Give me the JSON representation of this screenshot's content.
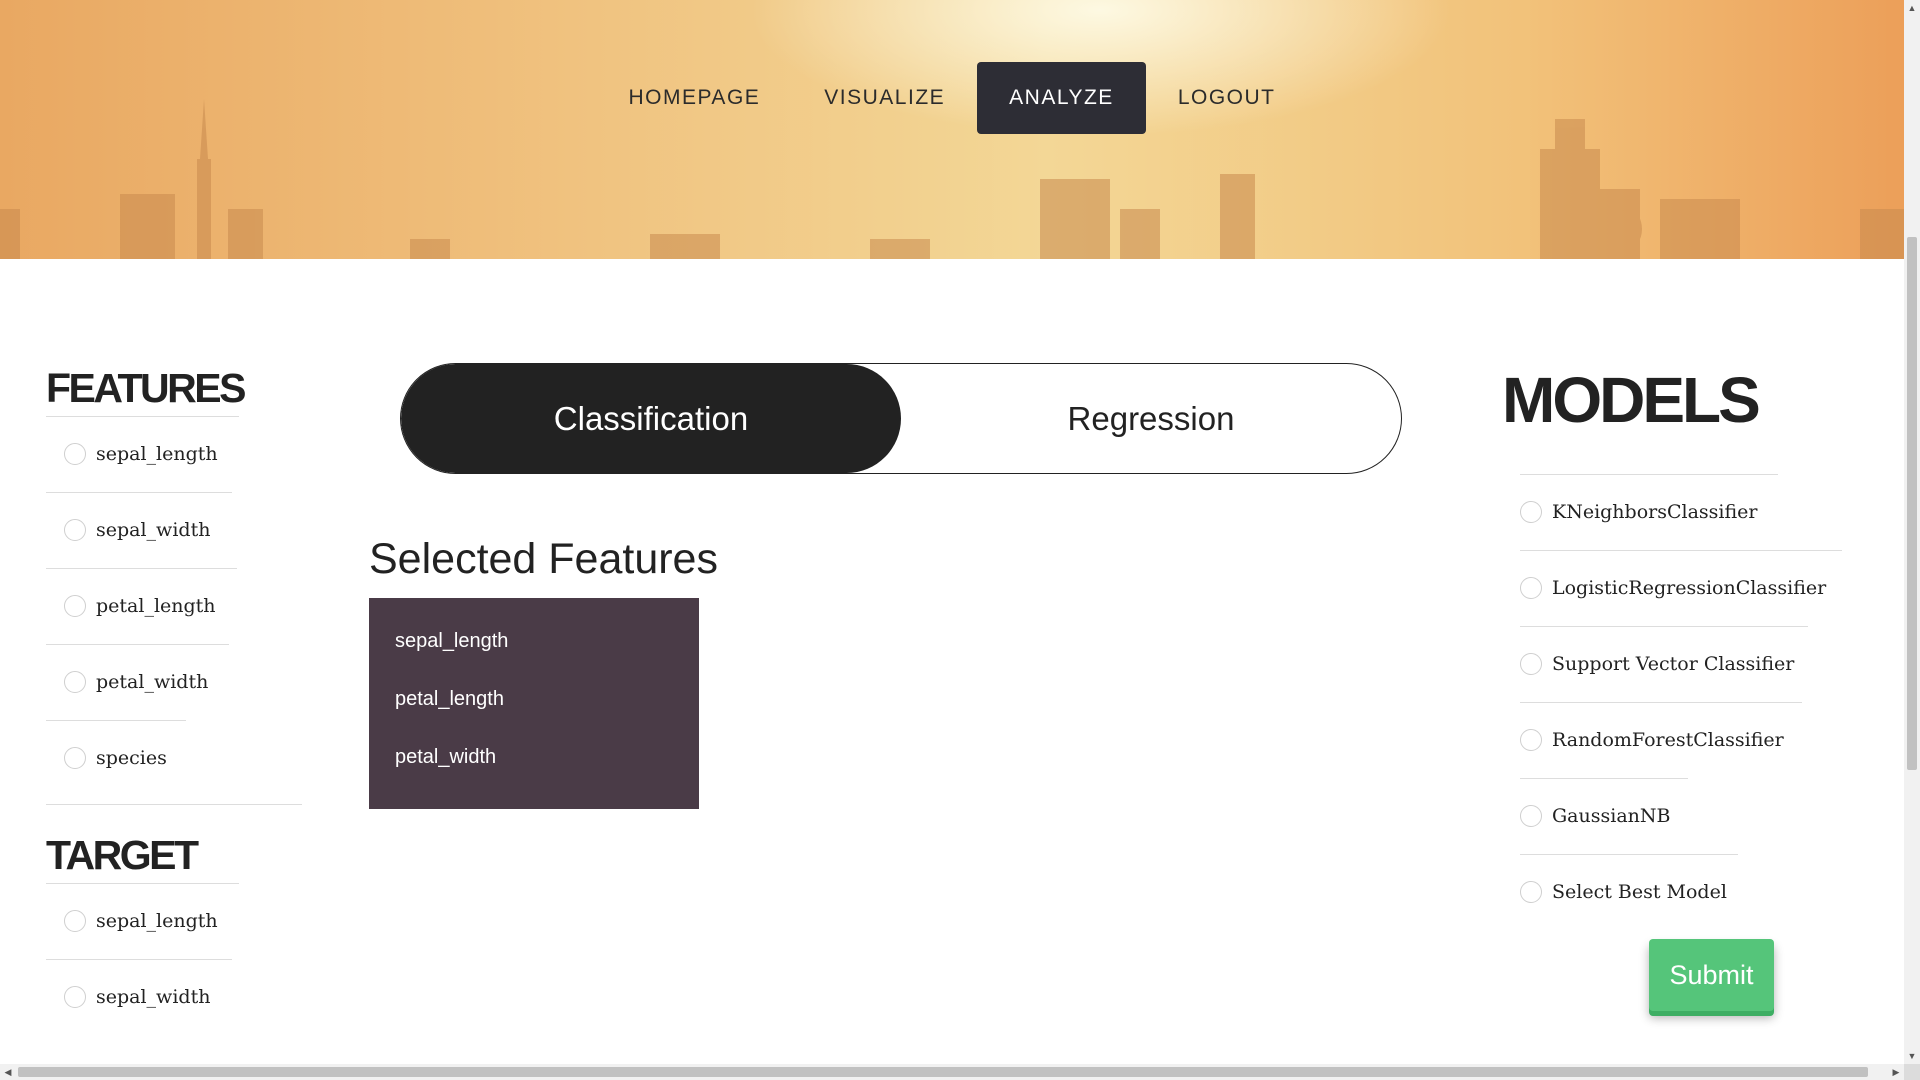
{
  "nav": {
    "items": [
      "HOMEPAGE",
      "VISUALIZE",
      "ANALYZE",
      "LOGOUT"
    ],
    "active": "ANALYZE"
  },
  "features": {
    "title": "FEATURES",
    "options": [
      "sepal_length",
      "sepal_width",
      "petal_length",
      "petal_width",
      "species"
    ]
  },
  "target": {
    "title": "TARGET",
    "options": [
      "sepal_length",
      "sepal_width"
    ]
  },
  "mode_toggle": {
    "options": [
      "Classification",
      "Regression"
    ],
    "active": "Classification"
  },
  "selected_features": {
    "title": "Selected Features",
    "items": [
      "sepal_length",
      "petal_length",
      "petal_width"
    ]
  },
  "models": {
    "title": "MODELS",
    "options": [
      "KNeighborsClassifier",
      "LogisticRegressionClassifier",
      "Support Vector Classifier",
      "RandomForestClassifier",
      "GaussianNB",
      "Select Best Model"
    ]
  },
  "submit_label": "Submit",
  "colors": {
    "nav_active_bg": "#2d2d35",
    "toggle_active_bg": "#222222",
    "selected_box_bg": "#4a3b47",
    "submit_bg": "#55c57a"
  }
}
